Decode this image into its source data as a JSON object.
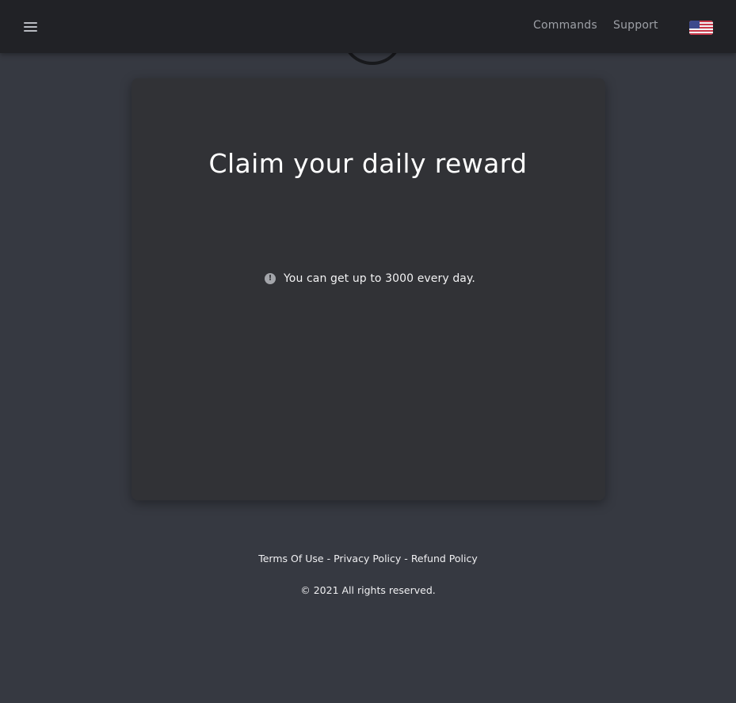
{
  "nav": {
    "menu_icon": "hamburger-menu-icon",
    "links": [
      {
        "label": "Commands"
      },
      {
        "label": "Support"
      }
    ],
    "language_flag": "us-flag-icon"
  },
  "card": {
    "title": "Claim your daily reward",
    "info_icon": "exclamation-circle-icon",
    "info_text": "You can get up to 3000 every day."
  },
  "footer": {
    "links": [
      {
        "label": "Terms Of Use"
      },
      {
        "label": "Privacy Policy"
      },
      {
        "label": "Refund Policy"
      }
    ],
    "separator": "-",
    "copyright": "© 2021 All rights reserved."
  },
  "colors": {
    "background": "#363941",
    "navbar": "#212226",
    "card": "#313236"
  }
}
